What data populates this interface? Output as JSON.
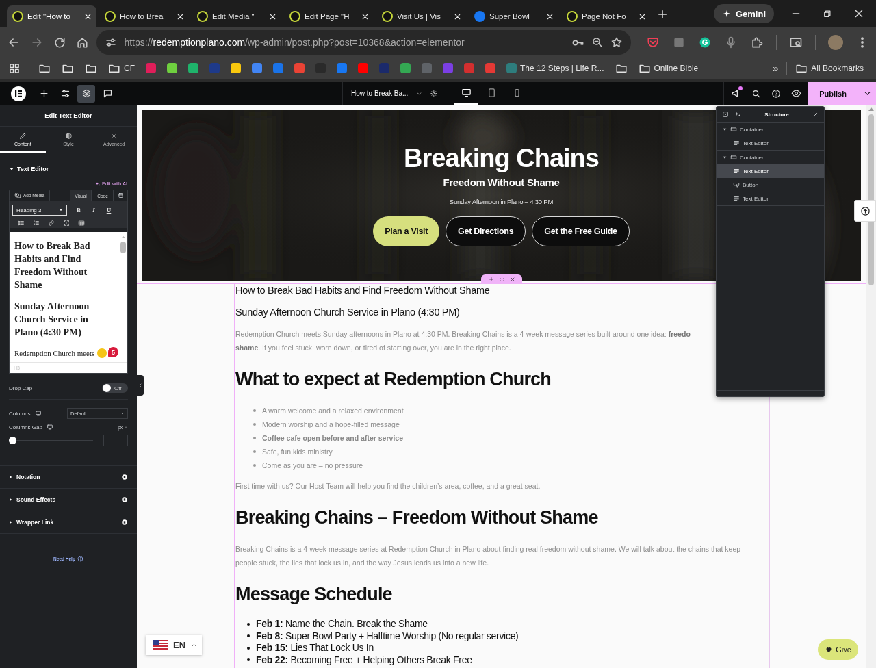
{
  "browser": {
    "tabs": [
      {
        "title": "Edit \"How to",
        "kind": "site",
        "selected": true
      },
      {
        "title": "How to Brea",
        "kind": "site",
        "selected": false
      },
      {
        "title": "Edit Media \"",
        "kind": "site",
        "selected": false
      },
      {
        "title": "Edit Page \"H",
        "kind": "site",
        "selected": false
      },
      {
        "title": "Visit Us | Vis",
        "kind": "site",
        "selected": false
      },
      {
        "title": "Super Bowl",
        "kind": "facebook",
        "selected": false
      },
      {
        "title": "Page Not Fo",
        "kind": "site",
        "selected": false
      }
    ],
    "gemini": "Gemini",
    "address": {
      "scheme": "https://",
      "domain": "redemptionplano.com",
      "path": "/wp-admin/post.php?post=10368&action=elementor"
    },
    "bookmarks": [
      {
        "kind": "folder"
      },
      {
        "kind": "folder"
      },
      {
        "kind": "folder"
      },
      {
        "kind": "folder",
        "label": "CF"
      },
      {
        "kind": "site",
        "color": "#e01e5a"
      },
      {
        "kind": "site",
        "color": "#6fcf3f"
      },
      {
        "kind": "site",
        "color": "#1fb36b"
      },
      {
        "kind": "site",
        "color": "#1e3a8a"
      },
      {
        "kind": "site",
        "color": "#f9c80e"
      },
      {
        "kind": "site",
        "color": "#4285f4"
      },
      {
        "kind": "site",
        "color": "#1a73e8"
      },
      {
        "kind": "site",
        "color": "#ea4335"
      },
      {
        "kind": "site",
        "color": "#2a2a2a"
      },
      {
        "kind": "site",
        "color": "#1877f2"
      },
      {
        "kind": "site",
        "color": "#ff0000"
      },
      {
        "kind": "site",
        "color": "#1b2a6b"
      },
      {
        "kind": "site",
        "color": "#34a853"
      },
      {
        "kind": "site",
        "color": "#5f6368"
      },
      {
        "kind": "site",
        "color": "#7b3fe4"
      },
      {
        "kind": "site",
        "color": "#d32f2f"
      },
      {
        "kind": "site",
        "color": "#e53935"
      },
      {
        "kind": "site",
        "color": "#2e7d7d",
        "label": "The 12 Steps | Life R..."
      },
      {
        "kind": "folder"
      },
      {
        "kind": "folder",
        "label": "Online Bible"
      }
    ],
    "more": "»",
    "all_bookmarks": "All Bookmarks"
  },
  "editor_bar": {
    "tools": [
      {
        "kind": "add",
        "selected": false
      },
      {
        "kind": "settings",
        "selected": false
      },
      {
        "kind": "structure",
        "selected": true
      },
      {
        "kind": "notes",
        "selected": false
      }
    ],
    "document_title": "How to Break Ba...",
    "devices": [
      {
        "kind": "desktop",
        "selected": true
      },
      {
        "kind": "tablet",
        "selected": false
      },
      {
        "kind": "mobile",
        "selected": false
      }
    ],
    "whats_new_dot": true,
    "publish": "Publish"
  },
  "panel": {
    "title": "Edit Text Editor",
    "tabs": [
      {
        "label": "Content",
        "selected": true
      },
      {
        "label": "Style",
        "selected": false
      },
      {
        "label": "Advanced",
        "selected": false
      }
    ],
    "section": {
      "label": "Text Editor",
      "expanded": true
    },
    "ai_link": "Edit with AI",
    "editor": {
      "add_media": "Add Media",
      "modes": [
        {
          "label": "Visual",
          "selected": true
        },
        {
          "label": "Code",
          "selected": false
        }
      ],
      "format": "Heading 3",
      "format_buttons": [
        "B",
        "I",
        "U"
      ],
      "content": [
        {
          "kind": "heading",
          "text": "How to Break Bad Habits and Find Freedom Without Shame"
        },
        {
          "kind": "heading",
          "text": "Sunday Afternoon Church Service in Plano (4:30 PM)"
        },
        {
          "kind": "paragraph",
          "text": "Redemption Church meets"
        }
      ],
      "badge_count": "5",
      "path": "H3"
    },
    "drop_cap": {
      "label": "Drop Cap",
      "on": false,
      "state_text": "Off"
    },
    "columns": {
      "label": "Columns",
      "value": "Default"
    },
    "columns_gap": {
      "label": "Columns Gap",
      "unit": "px",
      "level": 0
    },
    "sections": [
      {
        "label": "Notation",
        "expanded": false
      },
      {
        "label": "Sound Effects",
        "expanded": false
      },
      {
        "label": "Wrapper Link",
        "expanded": false
      }
    ],
    "help": "Need Help"
  },
  "canvas": {
    "hero": {
      "kind": "picture",
      "title": "Breaking Chains",
      "subtitle": "Freedom Without Shame",
      "tagline": "Sunday Afternoon in Plano – 4:30 PM",
      "buttons": [
        {
          "label": "Plan a Visit",
          "kind": "primary"
        },
        {
          "label": "Get Directions",
          "kind": "outline"
        },
        {
          "label": "Get the Free Guide",
          "kind": "outline"
        }
      ]
    },
    "blocks": [
      {
        "kind": "title",
        "text": "How to Break Bad Habits and Find Freedom Without Shame"
      },
      {
        "kind": "title",
        "text": "Sunday Afternoon Church Service in Plano (4:30 PM)"
      },
      {
        "kind": "lines",
        "lines": [
          "Redemption Church meets Sunday afternoons in Plano at 4:30 PM. Breaking Chains is a 4-week message series built around one idea: **freedo**",
          "**shame**. If you feel stuck, worn down, or tired of starting over, you are in the right place."
        ]
      },
      {
        "kind": "h2",
        "text": "What to expect at Redemption Church"
      },
      {
        "kind": "list",
        "items": [
          {
            "text": "A warm welcome and a relaxed environment",
            "bold": false
          },
          {
            "text": "Modern worship and a hope-filled message",
            "bold": false
          },
          {
            "text": "Coffee cafe open before and after service",
            "bold": true
          },
          {
            "text": "Safe, fun kids ministry",
            "bold": false
          },
          {
            "text": "Come as you are – no pressure",
            "bold": false
          }
        ]
      },
      {
        "kind": "paragraph",
        "text": "First time with us? Our Host Team will help you find the children’s area, coffee, and a great seat."
      },
      {
        "kind": "h2",
        "text": "Breaking Chains – Freedom Without Shame"
      },
      {
        "kind": "paragraph",
        "text": "Breaking Chains is a 4-week message series at Redemption Church in Plano about finding real freedom without shame. We will talk about the chains that keep people stuck, the lies that lock us in, and the way Jesus leads us into a new life."
      },
      {
        "kind": "h2",
        "text": "Message Schedule"
      },
      {
        "kind": "schedule",
        "items": [
          "**Feb 1:** Name the Chain. Break the Shame",
          "**Feb 8:** Super Bowl Party + Halftime Worship (No regular service)",
          "**Feb 15:** Lies That Lock Us In",
          "**Feb 22:** Becoming Free + Helping Others Break Free"
        ]
      }
    ],
    "language": "EN",
    "give": "Give"
  },
  "structure": {
    "title": "Structure",
    "tree": [
      {
        "label": "Container",
        "kind": "container",
        "expanded": true,
        "selected": false,
        "children": [
          {
            "label": "Text Editor",
            "kind": "text",
            "selected": false
          }
        ]
      },
      {
        "label": "Container",
        "kind": "container",
        "expanded": true,
        "selected": false,
        "children": [
          {
            "label": "Text Editor",
            "kind": "text",
            "selected": true
          },
          {
            "label": "Button",
            "kind": "button",
            "selected": false
          },
          {
            "label": "Text Editor",
            "kind": "text",
            "selected": false
          }
        ]
      }
    ]
  }
}
